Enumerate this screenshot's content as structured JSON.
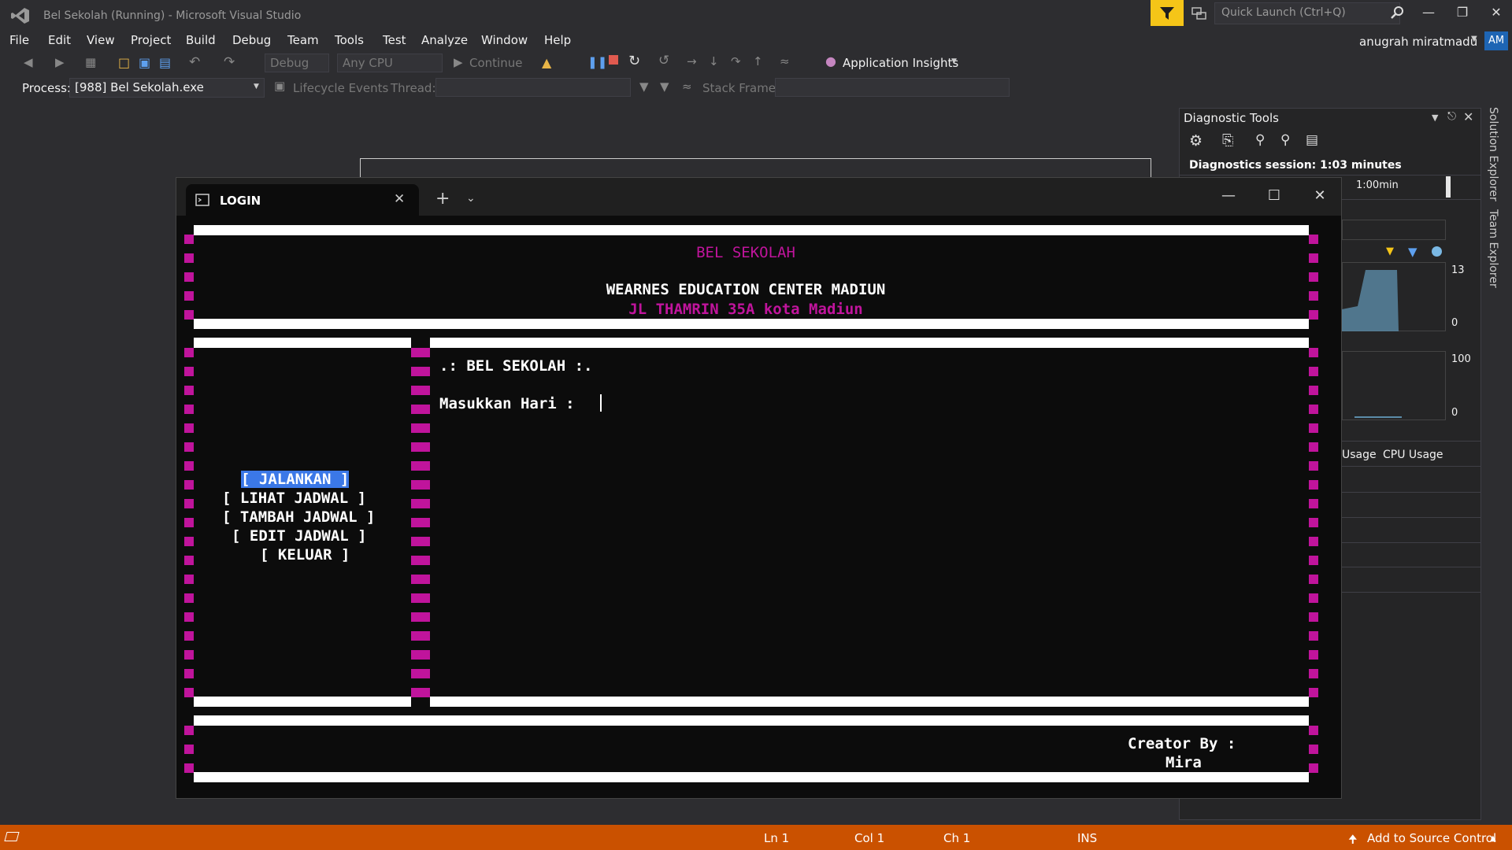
{
  "window": {
    "title": "Bel Sekolah (Running) - Microsoft Visual Studio",
    "quick_launch_placeholder": "Quick Launch (Ctrl+Q)",
    "user_name": "anugrah miratmadu",
    "avatar_initials": "AM"
  },
  "menu": {
    "items": [
      "File",
      "Edit",
      "View",
      "Project",
      "Build",
      "Debug",
      "Team",
      "Tools",
      "Test",
      "Analyze",
      "Window",
      "Help"
    ]
  },
  "toolbar": {
    "config": "Debug",
    "platform": "Any CPU",
    "continue_label": "Continue",
    "app_insights": "Application Insights",
    "process_label": "Process:",
    "process_value": "[988] Bel Sekolah.exe",
    "lifecycle_label": "Lifecycle Events",
    "thread_label": "Thread:",
    "stack_frame_label": "Stack Frame:"
  },
  "diagnostic_tools": {
    "title": "Diagnostic Tools",
    "session": "Diagnostics session: 1:03 minutes",
    "timeline_label": "1:00min",
    "mem_max": "13",
    "mem_min": "0",
    "cpu_max": "100",
    "cpu_min": "0",
    "tab_usage": "Usage",
    "tab_cpu": "CPU Usage"
  },
  "side_tabs": {
    "solution_explorer": "Solution Explorer",
    "team_explorer": "Team Explorer"
  },
  "console": {
    "tab_title": "LOGIN",
    "header_title": "BEL SEKOLAH",
    "org_name": "WEARNES EDUCATION CENTER MADIUN",
    "address": "JL THAMRIN 35A kota Madiun",
    "menu_items": [
      "[ JALANKAN ]",
      "[ LIHAT JADWAL ]",
      "[ TAMBAH JADWAL ]",
      "[ EDIT JADWAL ]",
      "[ KELUAR ]"
    ],
    "section_title": ".: BEL SEKOLAH :.",
    "prompt": "Masukkan Hari :",
    "creator_label": "Creator By :",
    "creator_name": "Mira"
  },
  "status_bar": {
    "ln": "Ln 1",
    "col": "Col 1",
    "ch": "Ch 1",
    "mode": "INS",
    "source_control": "Add to Source Control"
  },
  "colors": {
    "accent_magenta": "#c0149c",
    "selection_blue": "#3b78e7",
    "status_orange": "#ca5100",
    "filter_yellow": "#f5c518"
  }
}
